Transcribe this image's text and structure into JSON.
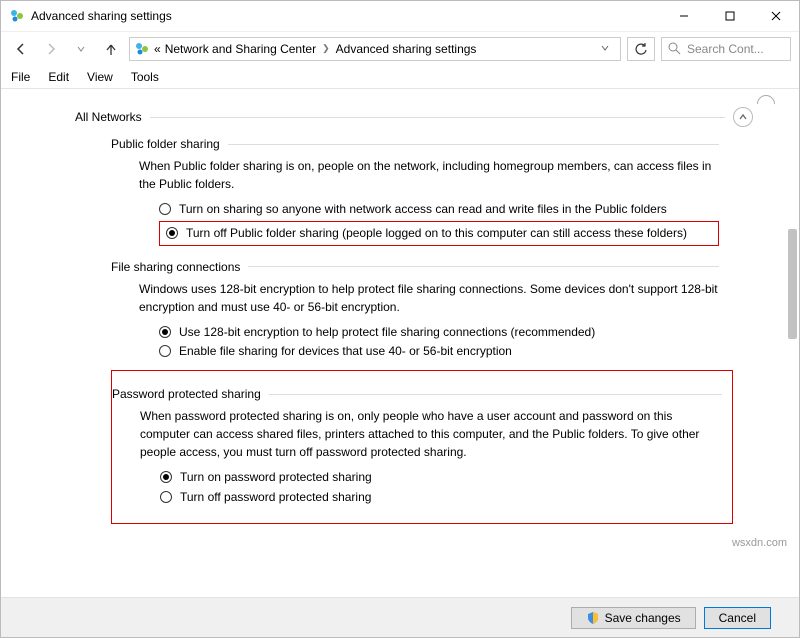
{
  "window": {
    "title": "Advanced sharing settings"
  },
  "breadcrumb": {
    "items": [
      "Network and Sharing Center",
      "Advanced sharing settings"
    ]
  },
  "search": {
    "placeholder": "Search Cont..."
  },
  "menu": {
    "file": "File",
    "edit": "Edit",
    "view": "View",
    "tools": "Tools"
  },
  "section": {
    "title": "All Networks"
  },
  "pfs": {
    "title": "Public folder sharing",
    "desc": "When Public folder sharing is on, people on the network, including homegroup members, can access files in the Public folders.",
    "opt_on": "Turn on sharing so anyone with network access can read and write files in the Public folders",
    "opt_off": "Turn off Public folder sharing (people logged on to this computer can still access these folders)"
  },
  "fsc": {
    "title": "File sharing connections",
    "desc": "Windows uses 128-bit encryption to help protect file sharing connections. Some devices don't support 128-bit encryption and must use 40- or 56-bit encryption.",
    "opt_128": "Use 128-bit encryption to help protect file sharing connections (recommended)",
    "opt_4056": "Enable file sharing for devices that use 40- or 56-bit encryption"
  },
  "pps": {
    "title": "Password protected sharing",
    "desc": "When password protected sharing is on, only people who have a user account and password on this computer can access shared files, printers attached to this computer, and the Public folders. To give other people access, you must turn off password protected sharing.",
    "opt_on": "Turn on password protected sharing",
    "opt_off": "Turn off password protected sharing"
  },
  "footer": {
    "save": "Save changes",
    "cancel": "Cancel"
  },
  "watermark": "wsxdn.com"
}
